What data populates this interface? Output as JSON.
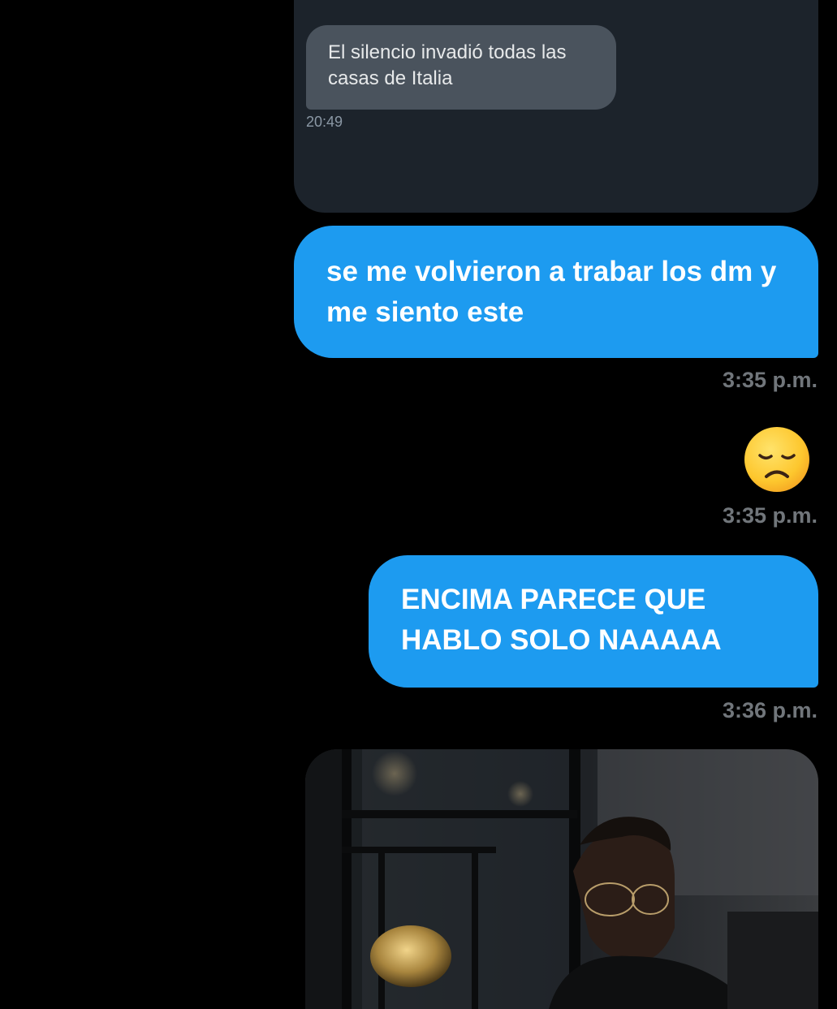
{
  "quoted_reply": {
    "text": "El silencio invadió todas las casas de Italia",
    "time": "20:49"
  },
  "messages": [
    {
      "text": "se me volvieron a trabar los dm y me siento este",
      "time": "3:35 p.m."
    },
    {
      "emoji": "disappointed-face-emoji",
      "time": "3:35 p.m."
    },
    {
      "text": "ENCIMA PARECE QUE HABLO SOLO NAAAAA",
      "time": "3:36 p.m."
    },
    {
      "image": "photo-man-glasses-trophy-display-case"
    }
  ],
  "colors": {
    "background": "#000000",
    "sent_bubble": "#1d9bf0",
    "quoted_card": "#1c232b",
    "quoted_bubble": "#4a535d",
    "timestamp": "#71767b"
  }
}
